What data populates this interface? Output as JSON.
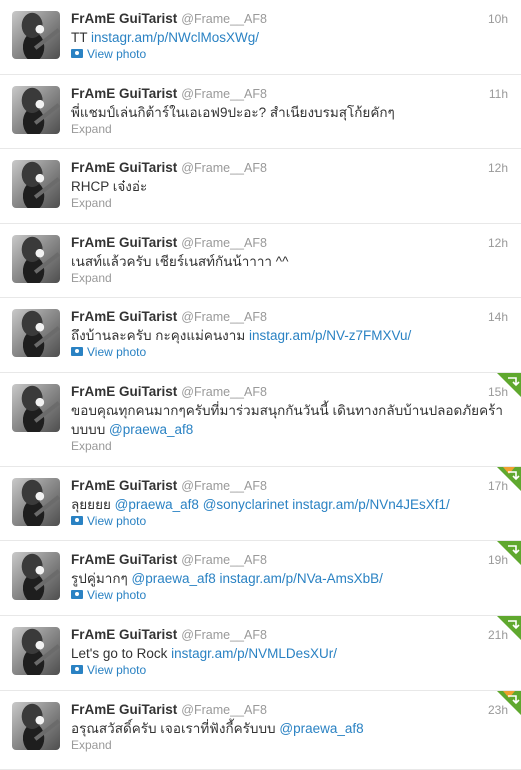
{
  "colors": {
    "link": "#2a82c3",
    "muted": "#999999",
    "text": "#333333",
    "retweet": "#5fa82e",
    "favorite": "#f0a030"
  },
  "tweets": [
    {
      "name": "FrAmE GuiTarist",
      "handle": "@Frame__AF8",
      "time": "10h",
      "segments": [
        {
          "t": "TT "
        },
        {
          "t": "instagr.am/p/NWclMosXWg/",
          "k": "link"
        }
      ],
      "action": "View photo",
      "action_type": "photo",
      "corner": "none"
    },
    {
      "name": "FrAmE GuiTarist",
      "handle": "@Frame__AF8",
      "time": "11h",
      "segments": [
        {
          "t": "พี่แชมป์เล่นกิต้าร์ในเอเอฟ9ปะอะ? สำเนียงบรมสุโก้ยคักๆ"
        }
      ],
      "action": "Expand",
      "action_type": "expand",
      "corner": "none"
    },
    {
      "name": "FrAmE GuiTarist",
      "handle": "@Frame__AF8",
      "time": "12h",
      "segments": [
        {
          "t": "RHCP เจ๋งอ่ะ"
        }
      ],
      "action": "Expand",
      "action_type": "expand",
      "corner": "none"
    },
    {
      "name": "FrAmE GuiTarist",
      "handle": "@Frame__AF8",
      "time": "12h",
      "segments": [
        {
          "t": "เนสท์แล้วครับ เชียร์เนสท์กันน้าาาา ^^"
        }
      ],
      "action": "Expand",
      "action_type": "expand",
      "corner": "none"
    },
    {
      "name": "FrAmE GuiTarist",
      "handle": "@Frame__AF8",
      "time": "14h",
      "segments": [
        {
          "t": "ถึงบ้านละครับ กะคุงแม่คนงาม "
        },
        {
          "t": "instagr.am/p/NV-z7FMXVu/",
          "k": "link"
        }
      ],
      "action": "View photo",
      "action_type": "photo",
      "corner": "none"
    },
    {
      "name": "FrAmE GuiTarist",
      "handle": "@Frame__AF8",
      "time": "15h",
      "segments": [
        {
          "t": "ขอบคุณทุกคนมากๆครับที่มาร่วมสนุกกันวันนี้ เดินทางกลับบ้านปลอดภัยคร้าบบบบ "
        },
        {
          "t": "@praewa_af8",
          "k": "mention"
        }
      ],
      "action": "Expand",
      "action_type": "expand",
      "corner": "retweet"
    },
    {
      "name": "FrAmE GuiTarist",
      "handle": "@Frame__AF8",
      "time": "17h",
      "segments": [
        {
          "t": "ลุยยยย "
        },
        {
          "t": "@praewa_af8",
          "k": "mention"
        },
        {
          "t": " "
        },
        {
          "t": "@sonyclarinet",
          "k": "mention"
        },
        {
          "t": " "
        },
        {
          "t": "instagr.am/p/NVn4JEsXf1/",
          "k": "link"
        }
      ],
      "action": "View photo",
      "action_type": "photo",
      "corner": "both"
    },
    {
      "name": "FrAmE GuiTarist",
      "handle": "@Frame__AF8",
      "time": "19h",
      "segments": [
        {
          "t": "รูปคู่มากๆ "
        },
        {
          "t": "@praewa_af8",
          "k": "mention"
        },
        {
          "t": " "
        },
        {
          "t": "instagr.am/p/NVa-AmsXbB/",
          "k": "link"
        }
      ],
      "action": "View photo",
      "action_type": "photo",
      "corner": "retweet"
    },
    {
      "name": "FrAmE GuiTarist",
      "handle": "@Frame__AF8",
      "time": "21h",
      "segments": [
        {
          "t": "Let's go to Rock "
        },
        {
          "t": "instagr.am/p/NVMLDesXUr/",
          "k": "link"
        }
      ],
      "action": "View photo",
      "action_type": "photo",
      "corner": "retweet"
    },
    {
      "name": "FrAmE GuiTarist",
      "handle": "@Frame__AF8",
      "time": "23h",
      "segments": [
        {
          "t": "อรุณสวัสดิ์ครับ เจอเราที่ฟังกี้ครับบบ "
        },
        {
          "t": "@praewa_af8",
          "k": "mention"
        }
      ],
      "action": "Expand",
      "action_type": "expand",
      "corner": "both"
    }
  ]
}
